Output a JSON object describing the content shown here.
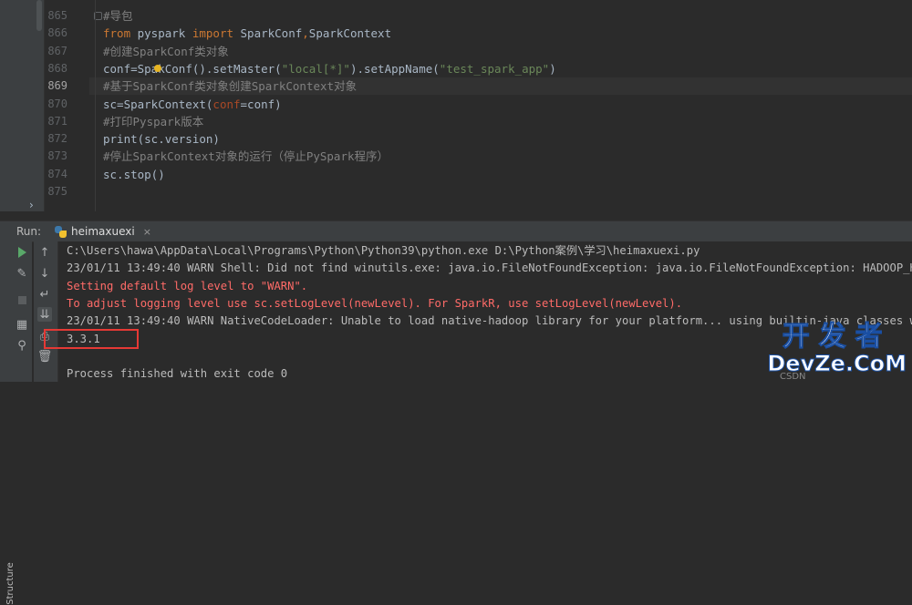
{
  "editor": {
    "line_numbers": [
      "865",
      "866",
      "867",
      "868",
      "869",
      "870",
      "871",
      "872",
      "873",
      "874",
      "875"
    ],
    "current_line": "869",
    "lines": [
      [
        {
          "t": "#导包",
          "c": "cm"
        }
      ],
      [
        {
          "t": "from",
          "c": "kw"
        },
        {
          "t": " pyspark "
        },
        {
          "t": "import",
          "c": "kw"
        },
        {
          "t": " SparkConf"
        },
        {
          "t": ",",
          "c": "kw"
        },
        {
          "t": "SparkContext"
        }
      ],
      [
        {
          "t": "#创建SparkConf类对象",
          "c": "cm"
        }
      ],
      [
        {
          "t": "conf=Spa"
        },
        {
          "t": "",
          "c": "bulb"
        },
        {
          "t": "kConf().setMaster("
        },
        {
          "t": "\"local[*]\"",
          "c": "str"
        },
        {
          "t": ").setAppName("
        },
        {
          "t": "\"test_spark_app\"",
          "c": "str"
        },
        {
          "t": ")"
        }
      ],
      [
        {
          "t": "#基于SparkConf类对象创建SparkContext对象",
          "c": "cm"
        }
      ],
      [
        {
          "t": "sc=SparkContext("
        },
        {
          "t": "conf",
          "c": "param"
        },
        {
          "t": "=conf)"
        }
      ],
      [
        {
          "t": "#打印Pyspark版本",
          "c": "cm"
        }
      ],
      [
        {
          "t": "print(sc.version)"
        }
      ],
      [
        {
          "t": "#停止SparkContext对象的运行（停止PySpark程序）",
          "c": "cm"
        }
      ],
      [
        {
          "t": "sc.stop()"
        }
      ],
      []
    ]
  },
  "run_panel": {
    "label": "Run:",
    "tab_label": "heimaxuexi",
    "side_label": "Structure"
  },
  "console": {
    "lines": [
      {
        "text": "C:\\Users\\hawa\\AppData\\Local\\Programs\\Python\\Python39\\python.exe D:\\Python案例\\学习\\heimaxuexi.py",
        "kind": "normal"
      },
      {
        "text": "23/01/11 13:49:40 WARN Shell: Did not find winutils.exe: java.io.FileNotFoundException: java.io.FileNotFoundException: HADOOP_HOME a",
        "kind": "normal"
      },
      {
        "text": "Setting default log level to \"WARN\".",
        "kind": "err"
      },
      {
        "text": "To adjust logging level use sc.setLogLevel(newLevel). For SparkR, use setLogLevel(newLevel).",
        "kind": "err"
      },
      {
        "text": "23/01/11 13:49:40 WARN NativeCodeLoader: Unable to load native-hadoop library for your platform... using builtin-java classes where",
        "kind": "normal"
      },
      {
        "text": "3.3.1",
        "kind": "normal"
      },
      {
        "text": "",
        "kind": "normal"
      },
      {
        "text": "Process finished with exit code 0",
        "kind": "normal"
      }
    ]
  },
  "watermark": {
    "cn": "开发者",
    "en": "DevZe.CoM",
    "csdn": "CSDN"
  },
  "colors": {
    "keyword": "#cc7832",
    "string": "#6a8759",
    "comment": "#808080",
    "error": "#ff6b68",
    "highlight_box": "#e53935"
  }
}
